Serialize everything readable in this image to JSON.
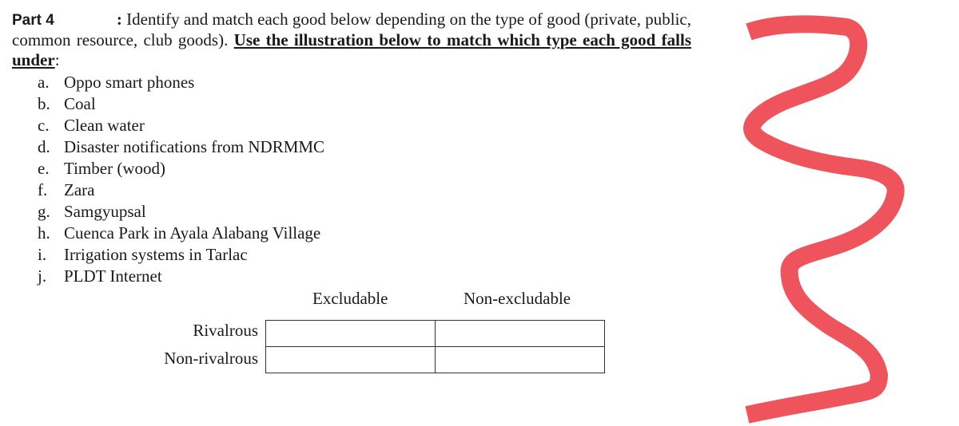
{
  "instructions": {
    "part_label": "Part 4",
    "colon": ":",
    "text": " Identify and match each good below depending on the type of good (private, public, common resource, club goods). ",
    "emphasis": "Use the illustration below to match which type each good falls under",
    "trailing": ":"
  },
  "goods": [
    {
      "marker": "a.",
      "label": "Oppo smart phones"
    },
    {
      "marker": "b.",
      "label": "Coal"
    },
    {
      "marker": "c.",
      "label": "Clean water"
    },
    {
      "marker": "d.",
      "label": "Disaster notifications from NDRMMC"
    },
    {
      "marker": "e.",
      "label": "Timber (wood)"
    },
    {
      "marker": "f.",
      "label": "Zara"
    },
    {
      "marker": "g.",
      "label": "Samgyupsal"
    },
    {
      "marker": "h.",
      "label": "Cuenca Park in Ayala Alabang Village"
    },
    {
      "marker": "i.",
      "label": "Irrigation systems in Tarlac"
    },
    {
      "marker": "j.",
      "label": "PLDT Internet"
    }
  ],
  "matrix": {
    "columns": [
      "Excludable",
      "Non-excludable"
    ],
    "rows": [
      "Rivalrous",
      "Non-rivalrous"
    ],
    "cells": [
      [
        "",
        ""
      ],
      [
        "",
        ""
      ]
    ]
  },
  "annotation": {
    "type": "freehand-scribble",
    "color": "#ef545c"
  }
}
